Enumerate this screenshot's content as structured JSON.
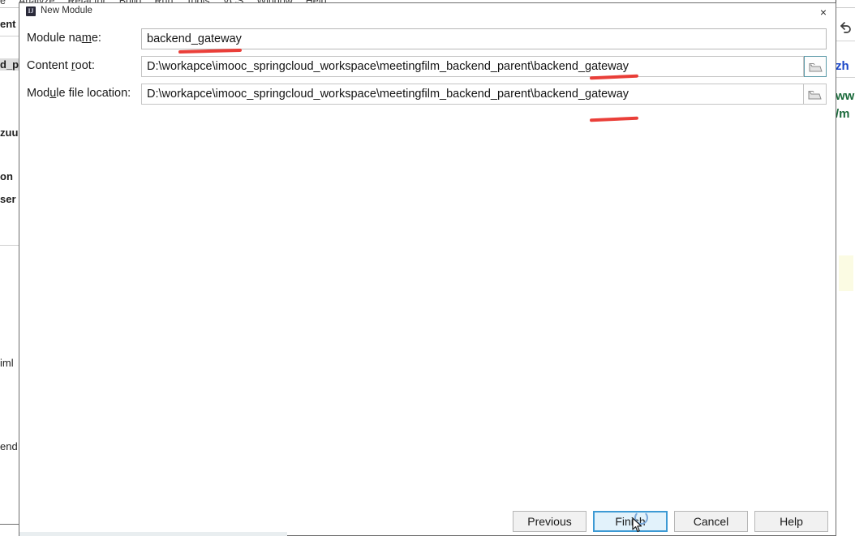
{
  "ide": {
    "menubar": [
      "e",
      "Analyze",
      "Refactor",
      "Build",
      "Run",
      "Tools",
      "VCS",
      "Window",
      "Help"
    ],
    "left_panel_fragments": [
      "ent",
      "d_p",
      "zuu",
      "on",
      "ser",
      "iml",
      "end"
    ],
    "right_panel_fragments": [
      "zh",
      "ww",
      "/m"
    ],
    "undo_icon": "undo-arrow-icon"
  },
  "dialog": {
    "title": "New Module",
    "icon": "intellij-idea-icon",
    "close_label": "×",
    "fields": [
      {
        "label_before": "Module na",
        "label_mnemonic": "m",
        "label_after": "e:",
        "value": "backend_gateway",
        "name": "module-name",
        "has_browse": false
      },
      {
        "label_before": "Content ",
        "label_mnemonic": "r",
        "label_after": "oot:",
        "value": "D:\\workapce\\imooc_springcloud_workspace\\meetingfilm_backend_parent\\backend_gateway",
        "name": "content-root",
        "has_browse": true
      },
      {
        "label_before": "Mod",
        "label_mnemonic": "u",
        "label_after": "le file location:",
        "value": "D:\\workapce\\imooc_springcloud_workspace\\meetingfilm_backend_parent\\backend_gateway",
        "name": "module-file-location",
        "has_browse": true
      }
    ],
    "buttons": [
      {
        "label": "Previous",
        "name": "previous-button",
        "default": false
      },
      {
        "label": "Finish",
        "name": "finish-button",
        "default": true
      },
      {
        "label": "Cancel",
        "name": "cancel-button",
        "default": false
      },
      {
        "label": "Help",
        "name": "help-button",
        "default": false
      }
    ]
  },
  "annotations": {
    "mark_color": "#e8302a",
    "marks": [
      "underline-under-module-name",
      "underline-under-content-root-tail",
      "underline-under-module-file-location-tail"
    ]
  }
}
